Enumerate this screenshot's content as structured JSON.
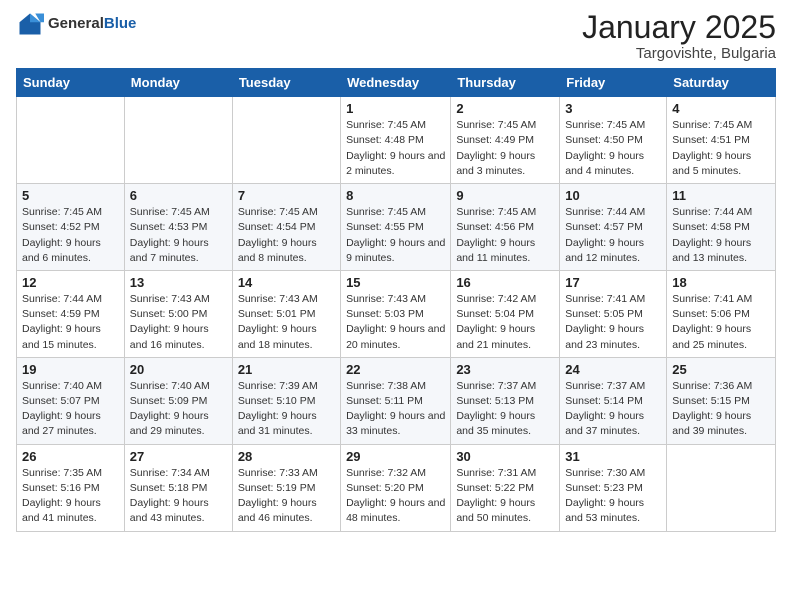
{
  "logo": {
    "general": "General",
    "blue": "Blue"
  },
  "header": {
    "month": "January 2025",
    "location": "Targovishte, Bulgaria"
  },
  "weekdays": [
    "Sunday",
    "Monday",
    "Tuesday",
    "Wednesday",
    "Thursday",
    "Friday",
    "Saturday"
  ],
  "weeks": [
    [
      {
        "day": "",
        "info": ""
      },
      {
        "day": "",
        "info": ""
      },
      {
        "day": "",
        "info": ""
      },
      {
        "day": "1",
        "info": "Sunrise: 7:45 AM\nSunset: 4:48 PM\nDaylight: 9 hours and 2 minutes."
      },
      {
        "day": "2",
        "info": "Sunrise: 7:45 AM\nSunset: 4:49 PM\nDaylight: 9 hours and 3 minutes."
      },
      {
        "day": "3",
        "info": "Sunrise: 7:45 AM\nSunset: 4:50 PM\nDaylight: 9 hours and 4 minutes."
      },
      {
        "day": "4",
        "info": "Sunrise: 7:45 AM\nSunset: 4:51 PM\nDaylight: 9 hours and 5 minutes."
      }
    ],
    [
      {
        "day": "5",
        "info": "Sunrise: 7:45 AM\nSunset: 4:52 PM\nDaylight: 9 hours and 6 minutes."
      },
      {
        "day": "6",
        "info": "Sunrise: 7:45 AM\nSunset: 4:53 PM\nDaylight: 9 hours and 7 minutes."
      },
      {
        "day": "7",
        "info": "Sunrise: 7:45 AM\nSunset: 4:54 PM\nDaylight: 9 hours and 8 minutes."
      },
      {
        "day": "8",
        "info": "Sunrise: 7:45 AM\nSunset: 4:55 PM\nDaylight: 9 hours and 9 minutes."
      },
      {
        "day": "9",
        "info": "Sunrise: 7:45 AM\nSunset: 4:56 PM\nDaylight: 9 hours and 11 minutes."
      },
      {
        "day": "10",
        "info": "Sunrise: 7:44 AM\nSunset: 4:57 PM\nDaylight: 9 hours and 12 minutes."
      },
      {
        "day": "11",
        "info": "Sunrise: 7:44 AM\nSunset: 4:58 PM\nDaylight: 9 hours and 13 minutes."
      }
    ],
    [
      {
        "day": "12",
        "info": "Sunrise: 7:44 AM\nSunset: 4:59 PM\nDaylight: 9 hours and 15 minutes."
      },
      {
        "day": "13",
        "info": "Sunrise: 7:43 AM\nSunset: 5:00 PM\nDaylight: 9 hours and 16 minutes."
      },
      {
        "day": "14",
        "info": "Sunrise: 7:43 AM\nSunset: 5:01 PM\nDaylight: 9 hours and 18 minutes."
      },
      {
        "day": "15",
        "info": "Sunrise: 7:43 AM\nSunset: 5:03 PM\nDaylight: 9 hours and 20 minutes."
      },
      {
        "day": "16",
        "info": "Sunrise: 7:42 AM\nSunset: 5:04 PM\nDaylight: 9 hours and 21 minutes."
      },
      {
        "day": "17",
        "info": "Sunrise: 7:41 AM\nSunset: 5:05 PM\nDaylight: 9 hours and 23 minutes."
      },
      {
        "day": "18",
        "info": "Sunrise: 7:41 AM\nSunset: 5:06 PM\nDaylight: 9 hours and 25 minutes."
      }
    ],
    [
      {
        "day": "19",
        "info": "Sunrise: 7:40 AM\nSunset: 5:07 PM\nDaylight: 9 hours and 27 minutes."
      },
      {
        "day": "20",
        "info": "Sunrise: 7:40 AM\nSunset: 5:09 PM\nDaylight: 9 hours and 29 minutes."
      },
      {
        "day": "21",
        "info": "Sunrise: 7:39 AM\nSunset: 5:10 PM\nDaylight: 9 hours and 31 minutes."
      },
      {
        "day": "22",
        "info": "Sunrise: 7:38 AM\nSunset: 5:11 PM\nDaylight: 9 hours and 33 minutes."
      },
      {
        "day": "23",
        "info": "Sunrise: 7:37 AM\nSunset: 5:13 PM\nDaylight: 9 hours and 35 minutes."
      },
      {
        "day": "24",
        "info": "Sunrise: 7:37 AM\nSunset: 5:14 PM\nDaylight: 9 hours and 37 minutes."
      },
      {
        "day": "25",
        "info": "Sunrise: 7:36 AM\nSunset: 5:15 PM\nDaylight: 9 hours and 39 minutes."
      }
    ],
    [
      {
        "day": "26",
        "info": "Sunrise: 7:35 AM\nSunset: 5:16 PM\nDaylight: 9 hours and 41 minutes."
      },
      {
        "day": "27",
        "info": "Sunrise: 7:34 AM\nSunset: 5:18 PM\nDaylight: 9 hours and 43 minutes."
      },
      {
        "day": "28",
        "info": "Sunrise: 7:33 AM\nSunset: 5:19 PM\nDaylight: 9 hours and 46 minutes."
      },
      {
        "day": "29",
        "info": "Sunrise: 7:32 AM\nSunset: 5:20 PM\nDaylight: 9 hours and 48 minutes."
      },
      {
        "day": "30",
        "info": "Sunrise: 7:31 AM\nSunset: 5:22 PM\nDaylight: 9 hours and 50 minutes."
      },
      {
        "day": "31",
        "info": "Sunrise: 7:30 AM\nSunset: 5:23 PM\nDaylight: 9 hours and 53 minutes."
      },
      {
        "day": "",
        "info": ""
      }
    ]
  ]
}
